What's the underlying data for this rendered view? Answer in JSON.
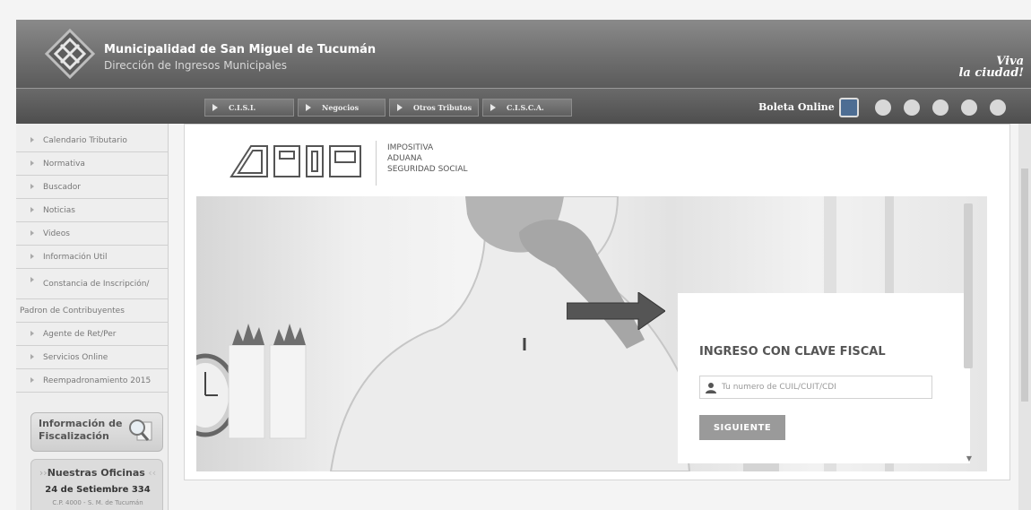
{
  "header": {
    "org_name": "Municipalidad de San Miguel de Tucumán",
    "org_subtitle": "Dirección de Ingresos Municipales",
    "slogan_line1": "Viva",
    "slogan_line2": "la ciudad!"
  },
  "navbar": {
    "tabs": [
      {
        "label": "C.I.S.I."
      },
      {
        "label": "Negocios"
      },
      {
        "label": "Otros Tributos"
      },
      {
        "label": "C.I.S.C.A."
      }
    ],
    "boleta_label": "Boleta Online",
    "icons": [
      "home-icon",
      "globe-icon",
      "mail-icon",
      "search-icon",
      "settings-icon"
    ]
  },
  "sidebar": {
    "items": [
      {
        "label": "Calendario Tributario"
      },
      {
        "label": "Normativa"
      },
      {
        "label": "Buscador"
      },
      {
        "label": "Noticias"
      },
      {
        "label": "Videos"
      },
      {
        "label": "Información Util"
      },
      {
        "label": "Constancia de Inscripción/"
      },
      {
        "label": "Padron de Contribuyentes"
      },
      {
        "label": "Agente de Ret/Per"
      },
      {
        "label": "Servicios Online"
      },
      {
        "label": "Reempadronamiento 2015"
      }
    ],
    "fiscalizacion_line1": "Información de",
    "fiscalizacion_line2": "Fiscalización",
    "oficinas_title": "Nuestras Oficinas",
    "oficinas_address": "24 de Setiembre 334",
    "oficinas_city": "C.P. 4000 - S. M. de Tucumán"
  },
  "main": {
    "afip_lines": [
      "IMPOSITIVA",
      "ADUANA",
      "SEGURIDAD SOCIAL"
    ],
    "login": {
      "title": "INGRESO CON CLAVE FISCAL",
      "placeholder": "Tu numero de CUIL/CUIT/CDI",
      "value": "",
      "button_label": "SIGUIENTE"
    }
  }
}
